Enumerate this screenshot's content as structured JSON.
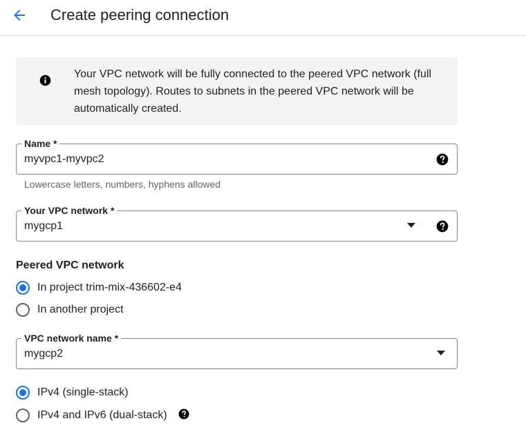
{
  "header": {
    "title": "Create peering connection",
    "back_icon": "arrow-back-icon"
  },
  "info": {
    "icon": "info-icon",
    "text": "Your VPC network will be fully connected to the peered VPC network (full mesh topology). Routes to subnets in the peered VPC network will be automatically created."
  },
  "name_field": {
    "label": "Name *",
    "value": "myvpc1-myvpc2",
    "hint": "Lowercase letters, numbers, hyphens allowed",
    "help_icon": "help-icon"
  },
  "vpc_network_field": {
    "label": "Your VPC network *",
    "value": "mygcp1",
    "dropdown_icon": "dropdown-arrow-icon",
    "help_icon": "help-icon"
  },
  "peered_vpc": {
    "title": "Peered VPC network",
    "options": [
      {
        "label": "In project trim-mix-436602-e4",
        "checked": true
      },
      {
        "label": "In another project",
        "checked": false
      }
    ]
  },
  "vpc_network_name_field": {
    "label": "VPC network name *",
    "value": "mygcp2",
    "dropdown_icon": "dropdown-arrow-icon"
  },
  "ip_stack": {
    "options": [
      {
        "label": "IPv4 (single-stack)",
        "checked": true
      },
      {
        "label": "IPv4 and IPv6 (dual-stack)",
        "checked": false
      }
    ],
    "help_icon": "help-icon"
  },
  "colors": {
    "accent": "#1a73e8",
    "text": "#202124",
    "secondary_text": "#5f6368",
    "info_background": "#f1f3f4",
    "border": "#80868b"
  }
}
